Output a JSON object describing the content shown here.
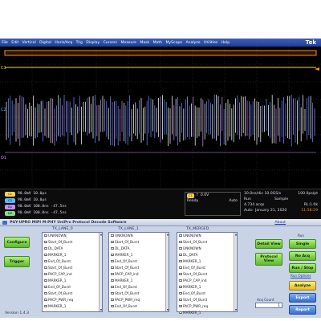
{
  "menubar": {
    "items": [
      "File",
      "Edit",
      "Vertical",
      "Digital",
      "Horiz/Acq",
      "Trig",
      "Display",
      "Cursors",
      "Measure",
      "Mask",
      "Math",
      "MyScope",
      "Analyze",
      "Utilities",
      "Help"
    ],
    "brand": "Tek"
  },
  "readout": {
    "channels": [
      {
        "tag": "C1",
        "value": "90.0mV  10.0µs",
        "color": "#ffd34a"
      },
      {
        "tag": "C2",
        "value": "90.0mV  10.0µs",
        "color": "#5cb8ff"
      },
      {
        "tag": "D1",
        "value": "90.0mV  100.0ns  -47.5ns",
        "color": "#c48ef5"
      },
      {
        "tag": "D2",
        "value": "90.0mV  100.0ns  -47.5ns",
        "color": "#7ee27e"
      }
    ],
    "trigger": {
      "tag": "C1",
      "level": "0.0V",
      "state": "Ready",
      "mode": "Auto"
    },
    "acq": {
      "timebase": "10.0ns/div 10.0GS/s",
      "resolution": "100.0ps/pt",
      "run": "Run",
      "sample": "Sample",
      "acqs": "4.734 acqs",
      "rl": "RL:1.0k",
      "auto": "Auto",
      "date": "January 21, 2020",
      "time": "11:58:29"
    }
  },
  "app": {
    "title": "PGY-UPRO MIPI M-PHY UniPro Protocol Decode Software",
    "about": "About",
    "version": "Version  1.4.3",
    "left_buttons": {
      "configure": "Configure",
      "trigger": "Trigger"
    },
    "lanes": [
      {
        "header": "TX_LANE_0",
        "items": [
          "UNKNOWN",
          "Start_Of_Burst",
          "DL_DATA",
          "MARKER_1",
          "End_Of_Burst",
          "Start_Of_Burst",
          "PACP_CAP_ind",
          "MARKER_1",
          "End_Of_Burst",
          "Start_Of_Burst",
          "PACP_PWR_req",
          "MARKER_1"
        ]
      },
      {
        "header": "TX_LANE_1",
        "items": [
          "UNKNOWN",
          "Start_Of_Burst",
          "DL_DATA",
          "MARKER_1",
          "End_Of_Burst",
          "Start_Of_Burst",
          "PACP_CAP_ind",
          "MARKER_1",
          "End_Of_Burst",
          "Start_Of_Burst",
          "PACP_PWR_req",
          "End_Of_Burst"
        ]
      },
      {
        "header": "TX_MERGED",
        "items": [
          "UNKNOWN",
          "Start_Of_Burst",
          "UNKNOWN",
          "DL_DATA",
          "MARKER_1",
          "End_Of_Burst",
          "Start_Of_Burst",
          "PACP_CAP_ind",
          "MARKER_1",
          "End_Of_Burst",
          "Start_Of_Burst",
          "PACP_PWR_req",
          "MARKER_1"
        ]
      }
    ],
    "view_buttons": {
      "detail": "Detail View",
      "protocol": "Protocol\nView"
    },
    "run": {
      "label": "Run",
      "single": "Single",
      "noacq": "No Acq",
      "runstop": "Run / Stop",
      "options": "Run Options",
      "analyze": "Analyze",
      "export": "Export",
      "report": "Report"
    },
    "acq_count": {
      "label": "Acq Count",
      "value": "1"
    }
  },
  "colors": {
    "ch1": "#ffd34a",
    "ch2": "#5cb8ff",
    "accent": "#3a6fcf",
    "green": "#5fba2c"
  }
}
